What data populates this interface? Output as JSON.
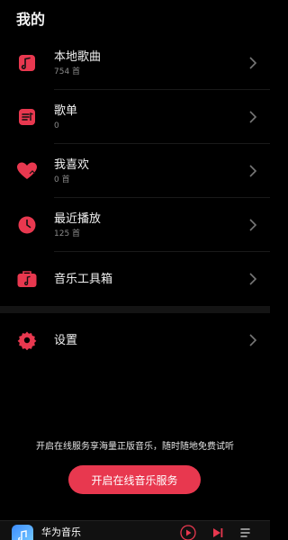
{
  "header": {
    "title": "我的"
  },
  "items": [
    {
      "label": "本地歌曲",
      "sub": "754 首",
      "icon": "local-music-icon"
    },
    {
      "label": "歌单",
      "sub": "0",
      "icon": "playlist-icon"
    },
    {
      "label": "我喜欢",
      "sub": "0 首",
      "icon": "heart-icon"
    },
    {
      "label": "最近播放",
      "sub": "125 首",
      "icon": "clock-icon"
    },
    {
      "label": "音乐工具箱",
      "sub": "",
      "icon": "toolbox-icon"
    }
  ],
  "settings": {
    "label": "设置",
    "icon": "gear-icon"
  },
  "promo": {
    "text": "开启在线服务享海量正版音乐，随时随地免费试听",
    "button": "开启在线音乐服务"
  },
  "player": {
    "title": "华为音乐"
  },
  "colors": {
    "accent": "#e8384f",
    "background": "#000000"
  }
}
